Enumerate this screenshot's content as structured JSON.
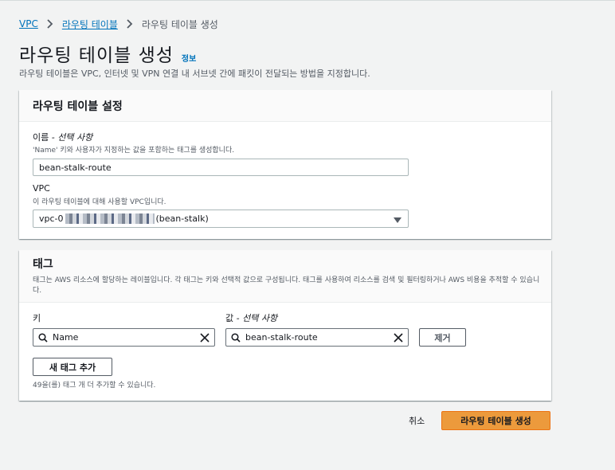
{
  "breadcrumb": {
    "items": [
      "VPC",
      "라우팅 테이블",
      "라우팅 테이블 생성"
    ]
  },
  "header": {
    "title": "라우팅 테이블 생성",
    "info_link": "정보",
    "description": "라우팅 테이블은 VPC, 인터넷 및 VPN 연결 내 서브넷 간에 패킷이 전달되는 방법을 지정합니다."
  },
  "settings": {
    "title": "라우팅 테이블 설정",
    "name_label": "이름",
    "name_optional": " - 선택 사항",
    "name_hint": "'Name' 키와 사용자가 지정하는 값을 포함하는 태그를 생성합니다.",
    "name_value": "bean-stalk-route",
    "vpc_label": "VPC",
    "vpc_hint": "이 라우팅 테이블에 대해 사용할 VPC입니다.",
    "vpc_prefix": "vpc-0",
    "vpc_suffix": "(bean-stalk)"
  },
  "tags": {
    "title": "태그",
    "description": "태그는 AWS 리소스에 할당하는 레이블입니다. 각 태그는 키와 선택적 값으로 구성됩니다. 태그를 사용하여 리소스를 검색 및 필터링하거나 AWS 비용을 추적할 수 있습니다.",
    "key_label": "키",
    "value_label": "값",
    "value_optional": " - 선택 사항",
    "key_value": "Name",
    "value_value": "bean-stalk-route",
    "remove_button": "제거",
    "add_button": "새 태그 추가",
    "remaining_hint": "49을(를) 태그 개 더 추가할 수 있습니다."
  },
  "footer": {
    "cancel": "취소",
    "submit": "라우팅 테이블 생성"
  },
  "colors": {
    "link": "#0073bb",
    "primary_button": "#ec9a3c",
    "background": "#f2f3f3"
  }
}
